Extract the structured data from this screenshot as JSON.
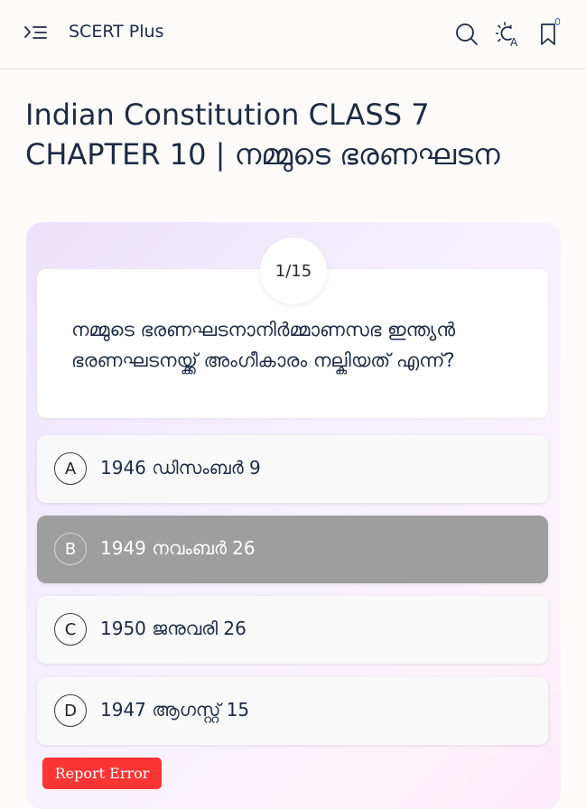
{
  "header": {
    "app_title": "SCERT Plus",
    "bookmark_count": "0",
    "icons": [
      "menu-icon",
      "search-icon",
      "theme-toggle-icon",
      "bookmark-icon"
    ]
  },
  "page": {
    "title": "Indian Constitution CLASS 7 CHAPTER 10 | നമ്മുടെ ഭരണഘടന"
  },
  "quiz": {
    "counter": "1/15",
    "question": "നമ്മുടെ ഭരണഘടനാനിർമ്മാണസഭ ഇന്ത്യൻ ഭരണഘടനയ്ക്ക് അംഗീകാരം നല്കിയത് എന്ന്?",
    "options": [
      {
        "letter": "A",
        "text": "1946 ഡിസംബർ 9"
      },
      {
        "letter": "B",
        "text": "1949 നവംബർ 26"
      },
      {
        "letter": "C",
        "text": "1950 ജനുവരി 26"
      },
      {
        "letter": "D",
        "text": "1947 ആഗസ്റ്റ് 15"
      }
    ],
    "selected_option": "B",
    "selected_color": "#9e9e9e"
  },
  "report_button": {
    "label": "Report Error",
    "color": "#fb3434"
  }
}
